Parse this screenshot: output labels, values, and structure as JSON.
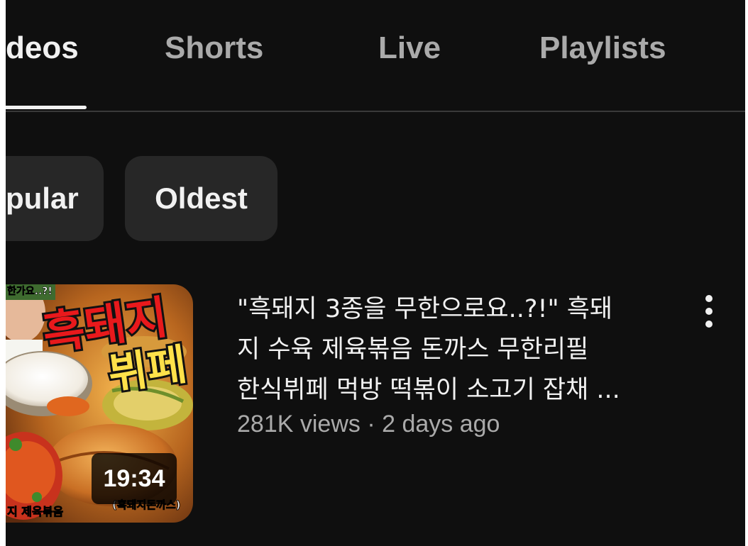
{
  "tabs": [
    {
      "label": "deos",
      "active": true
    },
    {
      "label": "Shorts",
      "active": false
    },
    {
      "label": "Live",
      "active": false
    },
    {
      "label": "Playlists",
      "active": false
    }
  ],
  "chips": [
    {
      "label": "pular"
    },
    {
      "label": "Oldest"
    }
  ],
  "video": {
    "title": "\"흑돼지 3종을 무한으로요..?!\" 흑돼\n지 수육 제육볶음 돈까스 무한리필\n한식뷔페 먹방 떡볶이 소고기 잡채 ...",
    "meta": "281K views · 2 days ago",
    "duration": "19:34",
    "thumbnail_text": {
      "big_line1": "흑돼지",
      "big_line2": "뷔페",
      "top_left": "한가요..?!",
      "bottom_left": "지 제육볶음",
      "bottom_right": "(흑돼지돈까스)"
    }
  },
  "colors": {
    "background": "#0f0f0f",
    "text_primary": "#f1f1f1",
    "text_secondary": "#aaaaaa",
    "chip_bg": "#272727",
    "thumb_title_red": "#e8191c"
  },
  "icons": {
    "more": "vertical-ellipsis-icon"
  }
}
